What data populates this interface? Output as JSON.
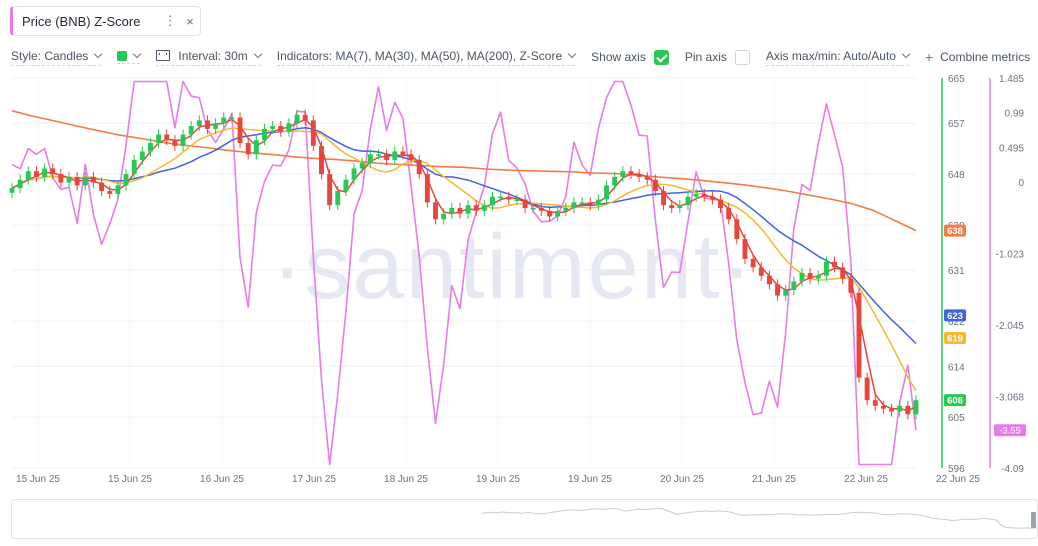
{
  "tab": {
    "title": "Price (BNB) Z-Score",
    "menu_icon": "⋮",
    "close_icon": "×"
  },
  "toolbar": {
    "style_label": "Style: Candles",
    "color_swatch": "#26c953",
    "interval_label": "Interval: 30m",
    "indicators_label": "Indicators: MA(7), MA(30), MA(50), MA(200), Z-Score",
    "show_axis_label": "Show axis",
    "show_axis_checked": true,
    "pin_axis_label": "Pin axis",
    "pin_axis_checked": false,
    "axis_minmax_label": "Axis max/min: Auto/Auto",
    "combine_label": "Combine metrics"
  },
  "watermark": "·santiment·",
  "colors": {
    "up": "#26c953",
    "down": "#e8453c",
    "ma7": "#e8453c",
    "ma30": "#f5b82e",
    "ma50": "#3f63e3",
    "ma200": "#f47b42",
    "zscore": "#e87be7",
    "price_axis": "#26c953",
    "z_axis": "#e87be7",
    "grid": "#eef0f3"
  },
  "chart_data": {
    "type": "line",
    "description_type": "candlestick price with moving averages and z-score overlay",
    "x_ticks": [
      "15 Jun 25",
      "15 Jun 25",
      "16 Jun 25",
      "17 Jun 25",
      "18 Jun 25",
      "19 Jun 25",
      "19 Jun 25",
      "20 Jun 25",
      "21 Jun 25",
      "22 Jun 25",
      "22 Jun 25"
    ],
    "price_axis": {
      "ticks": [
        665,
        657,
        648,
        639,
        631,
        622,
        614,
        605,
        596
      ],
      "ylim": [
        596,
        665
      ]
    },
    "z_axis": {
      "ticks": [
        1.485,
        0.99,
        0.495,
        0,
        -1.023,
        -2.045,
        -3.068,
        -4.09
      ],
      "ylim": [
        -4.09,
        1.485
      ]
    },
    "price_badges": [
      {
        "label": "638",
        "value": 638,
        "color": "#f47b42"
      },
      {
        "label": "623",
        "value": 623,
        "color": "#3f63e3"
      },
      {
        "label": "619",
        "value": 619,
        "color": "#f5b82e"
      },
      {
        "label": "608",
        "value": 608,
        "color": "#26c953"
      }
    ],
    "z_badge": {
      "label": "-3.55",
      "value": -3.55,
      "color": "#e87be7"
    },
    "close": [
      645.5,
      647,
      648.5,
      647.5,
      649,
      648,
      646.5,
      647.5,
      646,
      647.5,
      646.5,
      645,
      644.5,
      646,
      648,
      650.5,
      652,
      653.5,
      655,
      654,
      653,
      655,
      656.5,
      657.5,
      656,
      657,
      658,
      658,
      653.5,
      651.5,
      654,
      656,
      656.5,
      655.5,
      657,
      658.5,
      657.5,
      653,
      648,
      642.5,
      645,
      647,
      649,
      650,
      651.5,
      651.5,
      650.5,
      652,
      651.5,
      650.5,
      648,
      643,
      640,
      641,
      642,
      641,
      642.5,
      641.5,
      642.5,
      644,
      644,
      643.5,
      643.5,
      642,
      642,
      641.5,
      640.5,
      641.5,
      642,
      643,
      643,
      642.5,
      643.5,
      646,
      647.5,
      648.5,
      648,
      647.5,
      647,
      645,
      642.5,
      642,
      642.5,
      644,
      644.5,
      644,
      643.5,
      642,
      640,
      636.5,
      633,
      631.5,
      630,
      628.5,
      626.5,
      627.5,
      629,
      630.5,
      629.5,
      630,
      632.5,
      631.5,
      629.5,
      627,
      612,
      608,
      607,
      606.5,
      606,
      607,
      605.5,
      608
    ],
    "ma200": [
      659.2,
      658.2,
      657.4,
      656.5,
      655.7,
      654.9,
      654.3,
      653.6,
      653.1,
      652.7,
      652.2,
      651.8,
      651.5,
      651.1,
      650.8,
      650.6,
      650.3,
      649.9,
      649.7,
      649.5,
      649.3,
      649.2,
      648.9,
      648.7,
      648.6,
      648.5,
      648.4,
      648.2,
      648.1,
      647.8,
      647.5,
      647.2,
      646.9,
      646.5,
      646.1,
      645.6,
      645,
      644.3,
      643.6,
      642.8,
      641.6,
      639.8,
      638
    ]
  }
}
